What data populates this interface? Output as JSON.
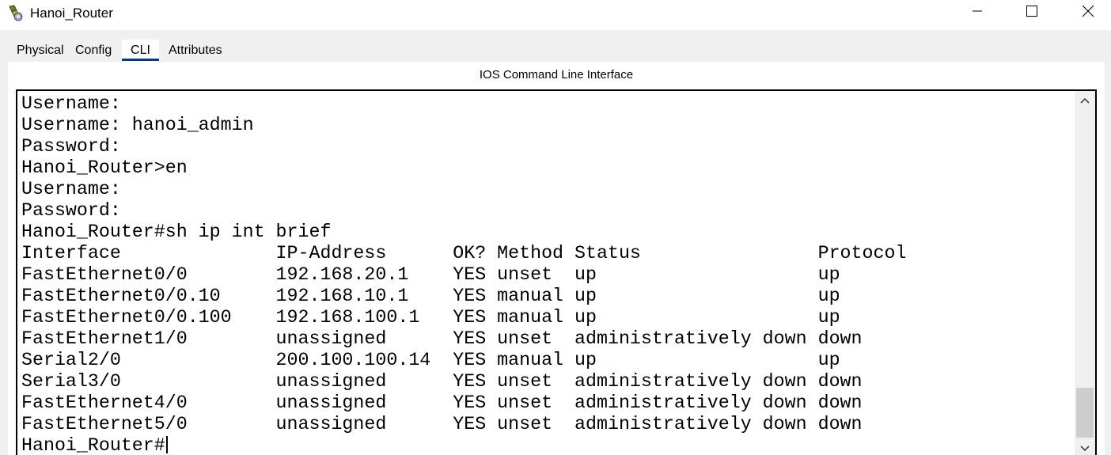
{
  "window": {
    "title": "Hanoi_Router",
    "icon": "router-app-icon",
    "controls": {
      "minimize": "minimize-icon",
      "maximize": "maximize-icon",
      "close": "close-icon"
    }
  },
  "tabs": [
    {
      "label": "Physical",
      "active": false
    },
    {
      "label": "Config",
      "active": false
    },
    {
      "label": "CLI",
      "active": true
    },
    {
      "label": "Attributes",
      "active": false
    }
  ],
  "panel": {
    "header": "IOS Command Line Interface"
  },
  "terminal": {
    "lines": [
      "Username:",
      "Username: hanoi_admin",
      "Password:",
      "Hanoi_Router>en",
      "Username:",
      "Password:",
      "Hanoi_Router#sh ip int brief",
      "Interface              IP-Address      OK? Method Status                Protocol",
      "FastEthernet0/0        192.168.20.1    YES unset  up                    up",
      "FastEthernet0/0.10     192.168.10.1    YES manual up                    up",
      "FastEthernet0/0.100    192.168.100.1   YES manual up                    up",
      "FastEthernet1/0        unassigned      YES unset  administratively down down",
      "Serial2/0              200.100.100.14  YES manual up                    up",
      "Serial3/0              unassigned      YES unset  administratively down down",
      "FastEthernet4/0        unassigned      YES unset  administratively down down",
      "FastEthernet5/0        unassigned      YES unset  administratively down down"
    ],
    "prompt": "Hanoi_Router#",
    "scroll_position": 0.86
  },
  "colors": {
    "tab_active_underline": "#0f3a6b",
    "body_background": "#f0f0f0",
    "terminal_border": "#000000"
  }
}
